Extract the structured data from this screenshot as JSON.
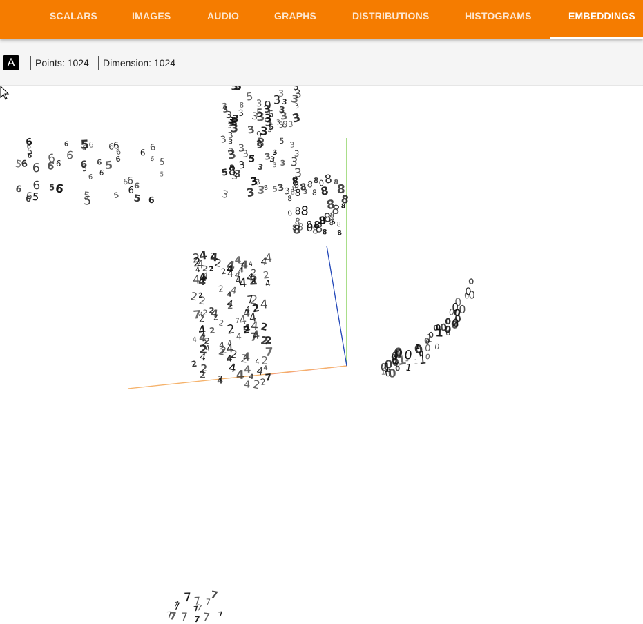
{
  "nav": {
    "tabs": [
      {
        "label": "SCALARS",
        "active": false
      },
      {
        "label": "IMAGES",
        "active": false
      },
      {
        "label": "AUDIO",
        "active": false
      },
      {
        "label": "GRAPHS",
        "active": false
      },
      {
        "label": "DISTRIBUTIONS",
        "active": false
      },
      {
        "label": "HISTOGRAMS",
        "active": false
      },
      {
        "label": "EMBEDDINGS",
        "active": true
      }
    ],
    "bar_color": "#f57c00"
  },
  "info": {
    "label_toggle_glyph": "A",
    "points": "Points: 1024",
    "dimension": "Dimension: 1024"
  },
  "projection": {
    "axis_colors": {
      "x": "#f28b82",
      "y": "#7ccc4c",
      "z": "#2046b8",
      "x_neg": "#f5b26b"
    },
    "clusters": [
      {
        "name": "sixes",
        "glyphs": "6666666655556665565"
      },
      {
        "name": "threes",
        "glyphs": "33333333333853339853333533"
      },
      {
        "name": "eights",
        "glyphs": "888880888883888"
      },
      {
        "name": "fours-twos",
        "glyphs": "4444444444442222222222277"
      },
      {
        "name": "zeros-ones",
        "glyphs": "0000000000001111"
      },
      {
        "name": "sevens",
        "glyphs": "777777"
      }
    ]
  }
}
